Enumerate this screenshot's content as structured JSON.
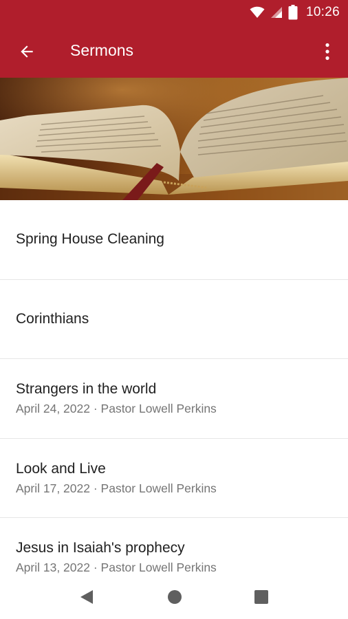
{
  "status_bar": {
    "time": "10:26"
  },
  "app_bar": {
    "title": "Sermons",
    "back_icon": "arrow-back-icon",
    "menu_icon": "more-vert-icon"
  },
  "colors": {
    "primary": "#b01e2c",
    "title_text": "#212121",
    "subtitle_text": "#757575"
  },
  "sermons": [
    {
      "title": "Spring House Cleaning",
      "subtitle": ""
    },
    {
      "title": "Corinthians",
      "subtitle": ""
    },
    {
      "title": "Strangers in the world",
      "subtitle": "April 24, 2022 · Pastor Lowell Perkins"
    },
    {
      "title": "Look and Live",
      "subtitle": "April 17, 2022 · Pastor Lowell Perkins"
    },
    {
      "title": "Jesus in Isaiah's prophecy",
      "subtitle": "April 13, 2022 · Pastor Lowell Perkins"
    }
  ]
}
